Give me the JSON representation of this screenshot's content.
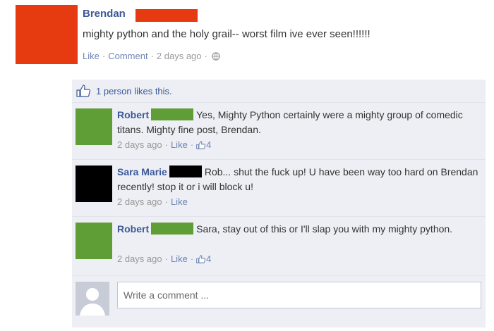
{
  "post": {
    "author": "Brendan",
    "text": "mighty python and the holy grail-- worst film ive ever seen!!!!!!",
    "like_label": "Like",
    "comment_label": "Comment",
    "time": "2 days ago",
    "redaction_color": "#e63a10"
  },
  "likes": {
    "text": "1 person likes this."
  },
  "comments": [
    {
      "author": "Robert",
      "text": "Yes, Mighty Python certainly were a mighty group of comedic titans. Mighty fine post, Brendan.",
      "time": "2 days ago",
      "like_label": "Like",
      "like_count": "4",
      "redaction_color": "#5f9e36"
    },
    {
      "author": "Sara Marie",
      "text": "Rob... shut the fuck up! U have been way too hard on Brendan recently! stop it or i will block u!",
      "time": "2 days ago",
      "like_label": "Like",
      "redaction_color": "#000000"
    },
    {
      "author": "Robert",
      "text": "Sara, stay out of this or I'll slap you with my mighty python.",
      "time": "2 days ago",
      "like_label": "Like",
      "like_count": "4",
      "redaction_color": "#5f9e36"
    }
  ],
  "composer": {
    "placeholder": "Write a comment ..."
  },
  "colors": {
    "link": "#3b5998",
    "meta_link": "#6d84b4",
    "comment_bg": "#edeff4"
  },
  "icons": {
    "like": "thumbs-up-icon",
    "privacy": "globe-icon",
    "avatar_placeholder": "default-avatar-icon"
  }
}
